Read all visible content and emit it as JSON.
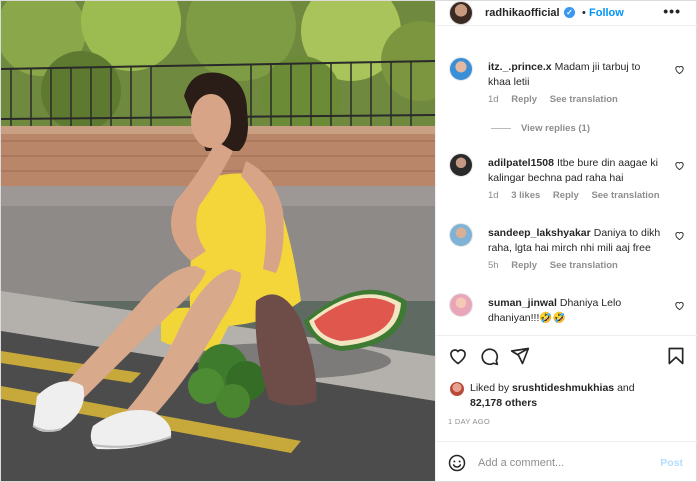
{
  "header": {
    "username": "radhikaofficial",
    "verified_icon": "verified-badge-icon",
    "separator": "•",
    "follow_label": "Follow",
    "more_label": "•••"
  },
  "photo": {
    "description_icon": "post-photo"
  },
  "comments": [
    {
      "username": "itz._.prince.x",
      "text": "Madam jii tarbuj to khaa letii",
      "time": "1d",
      "likes": "",
      "reply_label": "Reply",
      "translate_label": "See translation",
      "view_replies": "View replies (1)",
      "avatar_color": "#3b8fd6"
    },
    {
      "username": "adilpatel1508",
      "text": "Itbe bure din aagae ki kalingar bechna pad raha hai",
      "time": "1d",
      "likes": "3 likes",
      "reply_label": "Reply",
      "translate_label": "See translation",
      "avatar_color": "#2a2a2a"
    },
    {
      "username": "sandeep_lakshyakar",
      "text": "Daniya to dikh raha, lgta hai mirch nhi mili aaj free",
      "time": "5h",
      "likes": "",
      "reply_label": "Reply",
      "translate_label": "See translation",
      "avatar_color": "#7fb3d6"
    },
    {
      "username": "suman_jinwal",
      "text": "Dhaniya Lelo dhaniyan!!!🤣🤣",
      "time": "",
      "likes": "",
      "reply_label": "",
      "translate_label": "",
      "avatar_color": "#e8a6b8"
    }
  ],
  "actions": {
    "like_icon": "heart-icon",
    "comment_icon": "comment-icon",
    "share_icon": "share-icon",
    "save_icon": "bookmark-icon"
  },
  "likes": {
    "prefix": "Liked by ",
    "user": "srushtideshmukhias",
    "middle": " and",
    "count": "82,178 others"
  },
  "timestamp": "1 DAY AGO",
  "add_comment": {
    "placeholder": "Add a comment...",
    "post_label": "Post",
    "emoji_icon": "emoji-icon"
  },
  "colors": {
    "accent": "#0095f6",
    "muted": "#8e8e8e",
    "post_disabled": "#b2dffc"
  }
}
